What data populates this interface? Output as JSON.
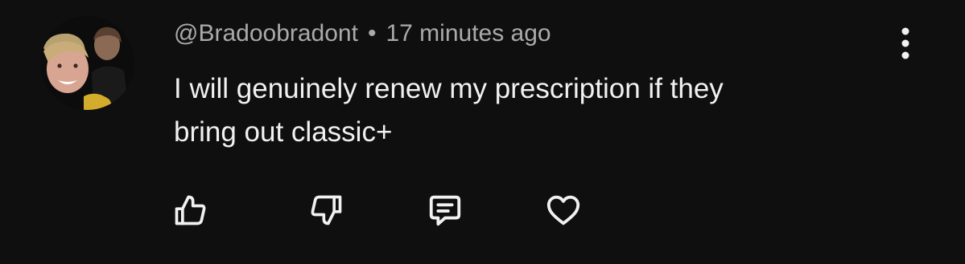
{
  "comment": {
    "author": "@Bradoobradont",
    "separator": "•",
    "time": "17 minutes ago",
    "text_lines": [
      "I will genuinely renew my prescription if they",
      "bring out classic+"
    ]
  },
  "icons": {
    "more": "vertical-dots-icon",
    "like": "thumbs-up-icon",
    "dislike": "thumbs-down-icon",
    "reply": "reply-comment-icon",
    "heart": "heart-icon"
  },
  "colors": {
    "background": "#0f0f0f",
    "text": "#f1f1f1",
    "meta": "#aaaaaa"
  }
}
